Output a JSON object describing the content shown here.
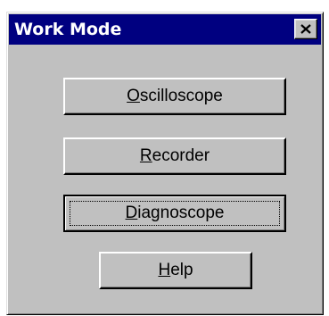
{
  "window": {
    "title": "Work Mode",
    "close_icon": "close-icon",
    "colors": {
      "titlebar": "#000080",
      "face": "#c0c0c0"
    }
  },
  "buttons": {
    "oscilloscope": {
      "accel": "O",
      "rest": "scilloscope"
    },
    "recorder": {
      "accel": "R",
      "rest": "ecorder"
    },
    "diagnoscope": {
      "accel": "D",
      "rest": "iagnoscope"
    },
    "help": {
      "accel": "H",
      "rest": "elp"
    }
  }
}
